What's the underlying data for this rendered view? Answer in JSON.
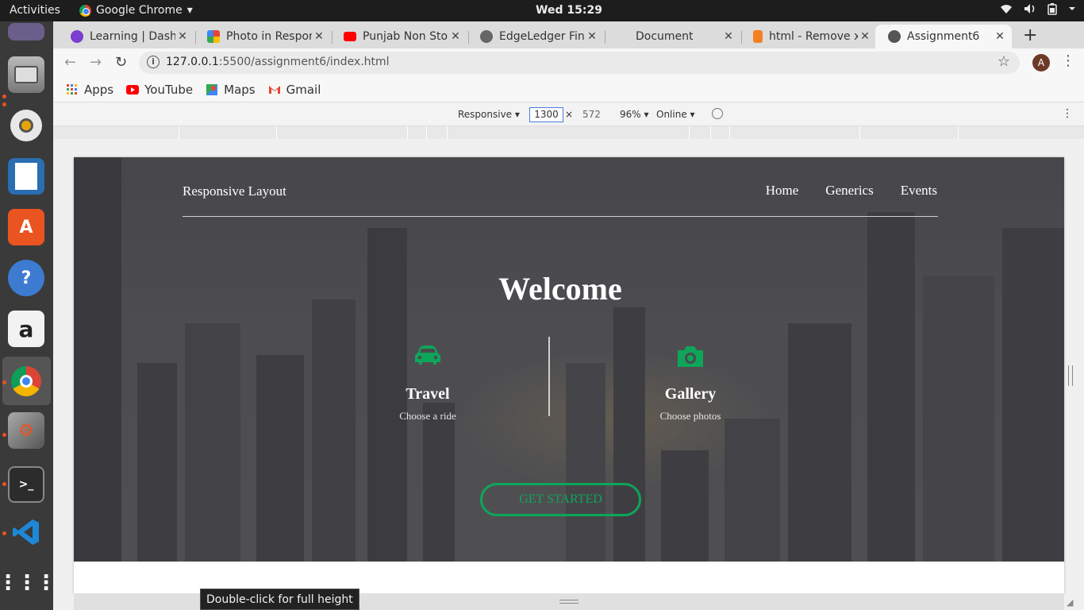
{
  "system": {
    "activities": "Activities",
    "app_name": "Google Chrome",
    "app_caret": "▾",
    "clock": "Wed 15:29"
  },
  "tabs": [
    {
      "title": "Learning | Dashb",
      "favicon_color": "#7a3fd1"
    },
    {
      "title": "Photo in Respons",
      "favicon_color": "#e8a21f"
    },
    {
      "title": "Punjab Non Stop",
      "favicon_color": "#ff0000"
    },
    {
      "title": "EdgeLedger Fina",
      "favicon_color": "#666666"
    },
    {
      "title": "Document",
      "favicon_color": "#dcdcdc"
    },
    {
      "title": "html - Remove x",
      "favicon_color": "#f48024"
    },
    {
      "title": "Assignment6",
      "favicon_color": "#555555"
    }
  ],
  "address": {
    "host": "127.0.0.1",
    "rest": ":5500/assignment6/index.html",
    "avatar_letter": "A"
  },
  "bookmarks": [
    {
      "label": "Apps",
      "icon": "apps-grid-icon"
    },
    {
      "label": "YouTube",
      "icon": "youtube-icon"
    },
    {
      "label": "Maps",
      "icon": "maps-icon"
    },
    {
      "label": "Gmail",
      "icon": "gmail-icon"
    }
  ],
  "devtools": {
    "device": "Responsive ▾",
    "width": "1300",
    "times": "×",
    "height": "572",
    "zoom": "96% ▾",
    "network": "Online ▾",
    "more": "⋮"
  },
  "site": {
    "logo": "Responsive Layout",
    "nav": [
      "Home",
      "Generics",
      "Events"
    ],
    "welcome": "Welcome",
    "features": [
      {
        "title": "Travel",
        "subtitle": "Choose a ride",
        "icon": "car-icon"
      },
      {
        "title": "Gallery",
        "subtitle": "Choose photos",
        "icon": "camera-icon"
      }
    ],
    "cta": "GET STARTED"
  },
  "accent": "#0ea55a",
  "tooltip": "Double-click for full height"
}
